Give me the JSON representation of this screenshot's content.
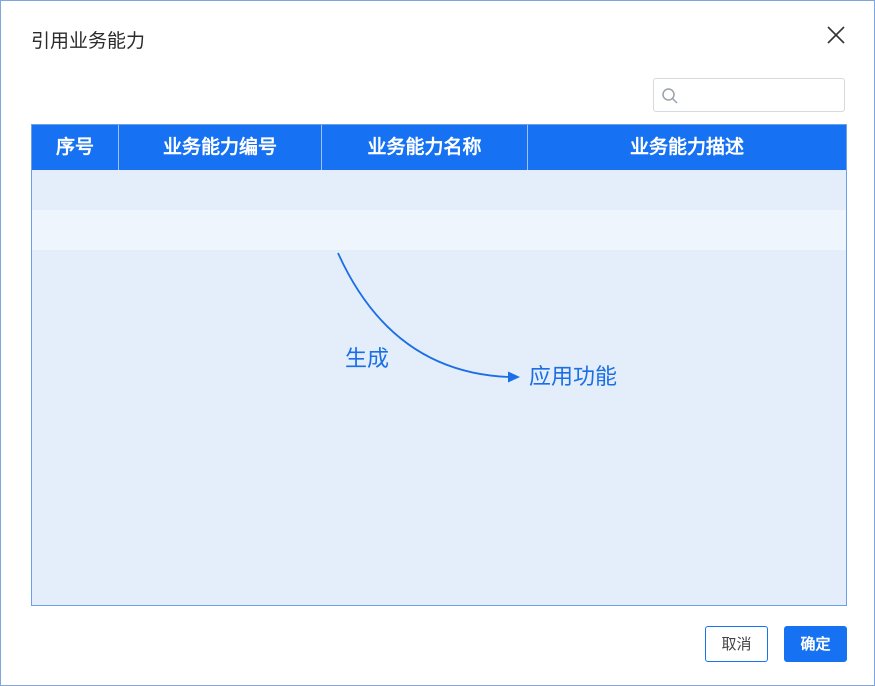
{
  "dialog": {
    "title": "引用业务能力",
    "close_icon": "close-icon"
  },
  "search": {
    "value": "",
    "placeholder": "",
    "icon": "search-icon"
  },
  "table": {
    "columns": [
      "序号",
      "业务能力编号",
      "业务能力名称",
      "业务能力描述"
    ],
    "rows": []
  },
  "annotation": {
    "source_label": "生成",
    "target_label": "应用功能"
  },
  "footer": {
    "cancel_label": "取消",
    "confirm_label": "确定"
  },
  "colors": {
    "accent": "#1672f2",
    "table_bg": "#e4eefb",
    "annotation": "#1a6ee6"
  }
}
